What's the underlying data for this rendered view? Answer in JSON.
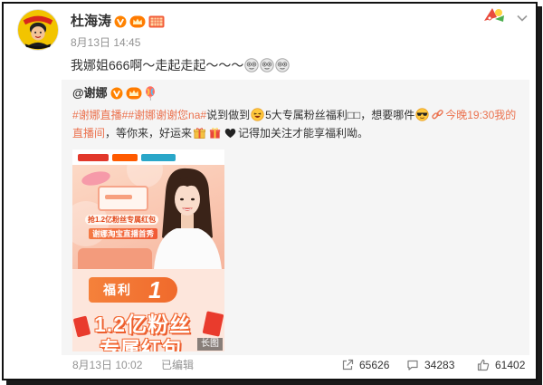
{
  "post": {
    "author": {
      "name": "杜海涛",
      "badges": [
        "verified-v-icon",
        "vip-crown-icon",
        "event-badge-icon"
      ]
    },
    "timestamp": "8月13日 14:45",
    "text": "我娜姐666啊～走起走起～～～",
    "trailing_emoji": [
      "star-eyes-emoji",
      "star-eyes-emoji",
      "star-eyes-emoji"
    ],
    "header_icons": [
      "card-decoration-icon",
      "chevron-down-icon"
    ]
  },
  "repost": {
    "author": "@谢娜",
    "author_badges": [
      "verified-v-icon",
      "vip-crown-icon",
      "balloon-icon"
    ],
    "text": {
      "hashtag_1": "#谢娜直播#",
      "hashtag_2": "#谢娜谢谢您na#",
      "segment_1": "说到做到",
      "emoji_1": "grin-emoji",
      "segment_2": "5大专属粉丝福利□□，想要哪件",
      "emoji_2": "sunglasses-emoji",
      "link_icon": "link-icon",
      "link_line_1": "今晚19:30我的",
      "link_line_2": "直播间",
      "segment_3": "，等你来，好运来",
      "emoji_3": [
        "gift-box-emoji",
        "red-gift-emoji",
        "black-heart-emoji"
      ],
      "segment_4": "记得加关注才能享福利呦。"
    },
    "image": {
      "hero_line_1": "抢1.2亿粉丝专属红包",
      "hero_line_2": "谢娜淘宝直播首秀",
      "ribbon_label": "福利",
      "ribbon_number": "1",
      "big_line_1": "1.2亿粉丝",
      "big_line_2": "专属红包"
    },
    "image_label": "长图"
  },
  "footer": {
    "timestamp": "8月13日 10:02",
    "edited": "已编辑",
    "actions": [
      {
        "icon": "share-icon",
        "count": "65626"
      },
      {
        "icon": "comment-icon",
        "count": "34283"
      },
      {
        "icon": "like-icon",
        "count": "61402"
      }
    ]
  },
  "colors": {
    "accent": "#eb7350",
    "text": "#333333",
    "muted": "#939393",
    "repost_bg": "#f5f5f5",
    "verified": "#ff8200"
  }
}
